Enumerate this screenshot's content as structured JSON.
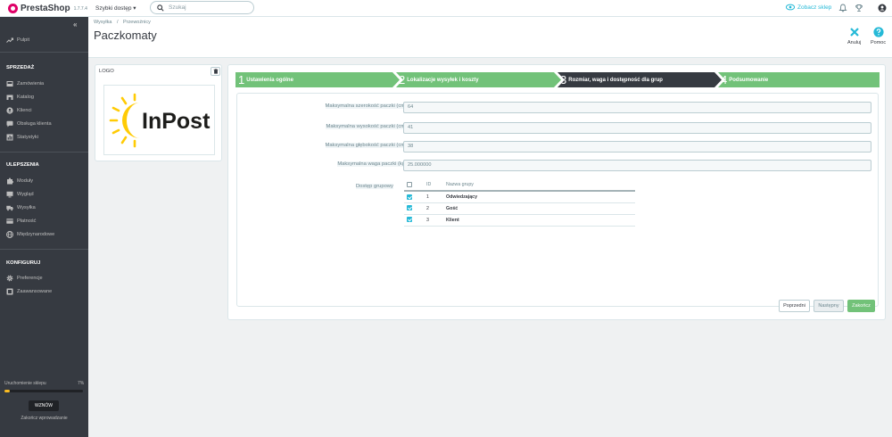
{
  "topbar": {
    "logo_text": "PrestaShop",
    "version": "1.7.7.4",
    "quick_access": "Szybki dostęp",
    "search_placeholder": "Szukaj",
    "view_shop": "Zobacz sklep"
  },
  "sidebar": {
    "dashboard": "Pulpit",
    "sections": [
      {
        "title": "SPRZEDAŻ",
        "items": [
          "Zamówienia",
          "Katalog",
          "Klienci",
          "Obsługa klienta",
          "Statystyki"
        ]
      },
      {
        "title": "ULEPSZENIA",
        "items": [
          "Moduły",
          "Wygląd",
          "Wysyłka",
          "Płatność",
          "Międzynarodowe"
        ]
      },
      {
        "title": "KONFIGURUJ",
        "items": [
          "Preferencje",
          "Zaawansowane"
        ]
      }
    ],
    "launch_label": "Uruchomienie sklepu",
    "launch_percent": "7%",
    "launch_progress": 0.07,
    "resume_label": "WZNÓW",
    "finish_link": "Zakończ wprowadzanie"
  },
  "header": {
    "breadcrumb_1": "Wysyłka",
    "breadcrumb_sep": "/",
    "breadcrumb_2": "Przewoźnicy",
    "title": "Paczkomaty",
    "cancel_label": "Anuluj",
    "help_label": "Pomoc"
  },
  "logo_panel": {
    "title": "LOGO",
    "brand_text": "InPost"
  },
  "wizard": {
    "steps": [
      {
        "num": "1",
        "label": "Ustawienia ogólne",
        "state": "done"
      },
      {
        "num": "2",
        "label": "Lokalizacje wysyłek i koszty",
        "state": "done"
      },
      {
        "num": "3",
        "label": "Rozmiar, waga i dostępność dla grup",
        "state": "active"
      },
      {
        "num": "4",
        "label": "Podsumowanie",
        "state": "todo"
      }
    ],
    "fields": [
      {
        "label": "Maksymalna szerokość paczki (cm)",
        "value": "64"
      },
      {
        "label": "Maksymalna wysokość paczki (cm)",
        "value": "41"
      },
      {
        "label": "Maksymalna głębokość paczki (cm)",
        "value": "38"
      },
      {
        "label": "Maksymalna waga paczki (kg)",
        "value": "25.000000"
      }
    ],
    "group_label": "Dostęp grupowy",
    "group_table": {
      "headers": [
        "ID",
        "Nazwa grupy"
      ],
      "rows": [
        {
          "id": "1",
          "name": "Odwiedzający",
          "checked": true
        },
        {
          "id": "2",
          "name": "Gość",
          "checked": true
        },
        {
          "id": "3",
          "name": "Klient",
          "checked": true
        }
      ]
    },
    "btn_prev": "Poprzedni",
    "btn_next": "Następny",
    "btn_finish": "Zakończ"
  },
  "colors": {
    "step_done": "#72c279",
    "step_active": "#363a41",
    "accent": "#25b9d7",
    "sidebar_bg": "#363a41",
    "inpost_yellow": "#ffcb05"
  }
}
